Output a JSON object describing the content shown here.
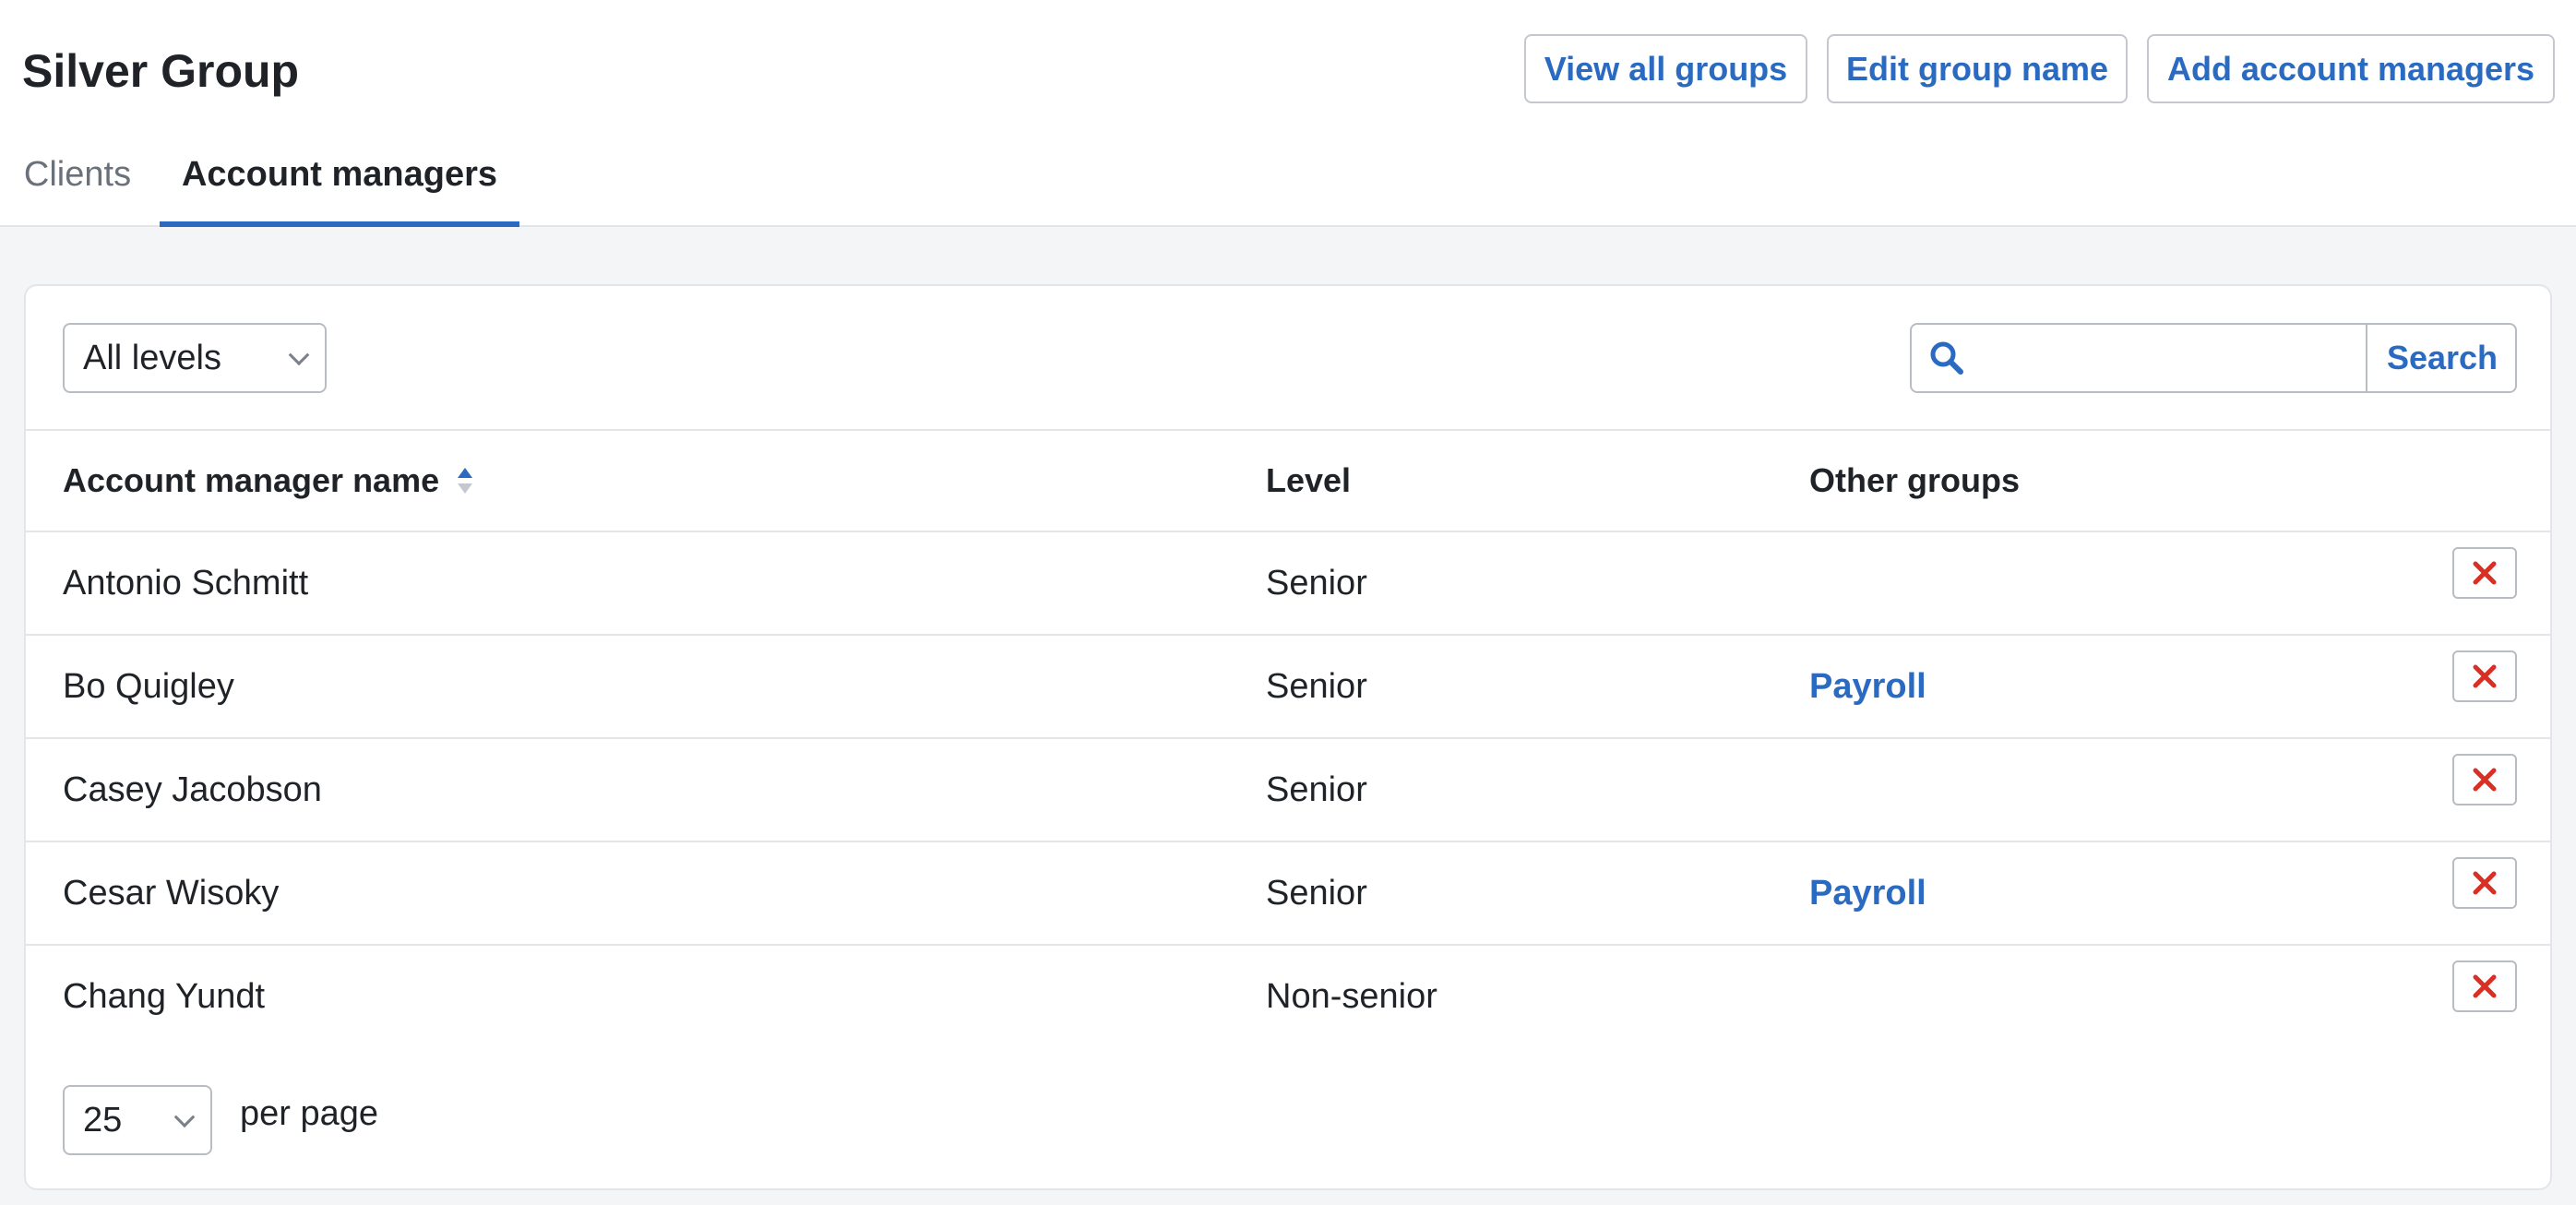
{
  "header": {
    "title": "Silver Group",
    "buttons": {
      "view_all_groups": "View all groups",
      "edit_group_name": "Edit group name",
      "add_account_managers": "Add account managers"
    }
  },
  "tabs": [
    {
      "label": "Clients",
      "active": false
    },
    {
      "label": "Account managers",
      "active": true
    }
  ],
  "filters": {
    "level_select": {
      "value": "All levels"
    },
    "search": {
      "placeholder": "",
      "value": "",
      "button_label": "Search"
    }
  },
  "table": {
    "columns": [
      "Account manager name",
      "Level",
      "Other groups"
    ],
    "sorted_by": "Account manager name",
    "rows": [
      {
        "name": "Antonio Schmitt",
        "level": "Senior",
        "other_groups": ""
      },
      {
        "name": "Bo Quigley",
        "level": "Senior",
        "other_groups": "Payroll"
      },
      {
        "name": "Casey Jacobson",
        "level": "Senior",
        "other_groups": ""
      },
      {
        "name": "Cesar Wisoky",
        "level": "Senior",
        "other_groups": "Payroll"
      },
      {
        "name": "Chang Yundt",
        "level": "Non-senior",
        "other_groups": ""
      }
    ]
  },
  "pagination": {
    "per_page_value": "25",
    "per_page_label": "per page"
  },
  "colors": {
    "accent": "#2a6ac1",
    "danger": "#d93025",
    "border": "#e3e5e8",
    "background": "#f4f5f7"
  },
  "icons": {
    "search": "search-icon",
    "sort": "sort-icon",
    "remove": "close-icon",
    "dropdown": "chevron-down-icon"
  }
}
